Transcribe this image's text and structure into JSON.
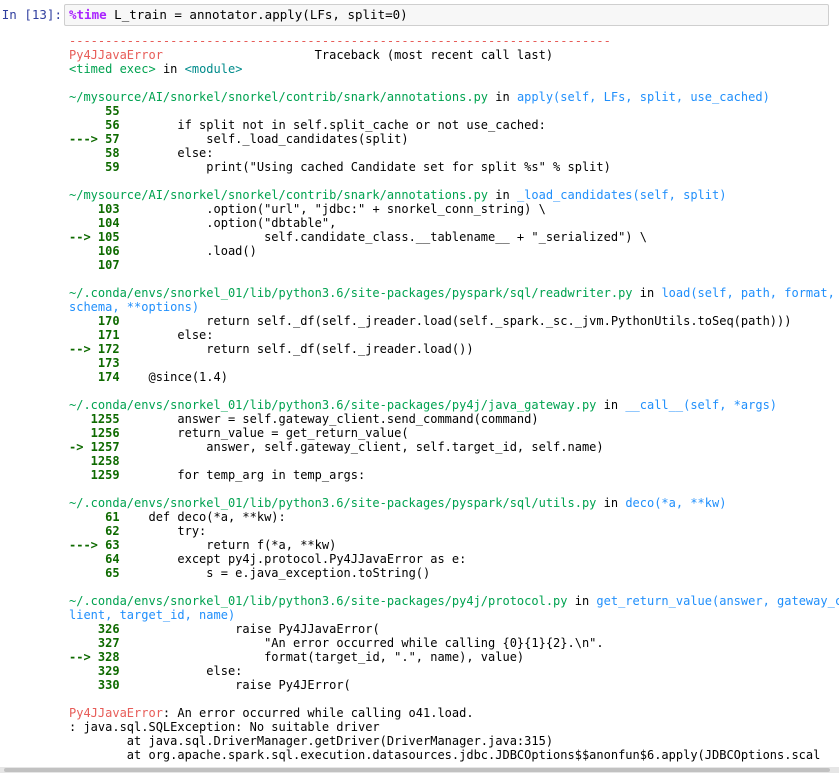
{
  "cell": {
    "prompt": "In [13]:",
    "magic": "%time",
    "code_rest": " L_train = annotator.apply(LFs, split=0)"
  },
  "output": {
    "separator": "---------------------------------------------------------------------------",
    "error_name": "Py4JJavaError",
    "traceback_label": "Traceback (most recent call last)",
    "timed_exec": "<timed exec>",
    "in_word": "in",
    "module": "<module>",
    "frames": [
      {
        "path": "~/mysource/AI/snorkel/snorkel/contrib/snark/annotations.py",
        "func": "apply(self, LFs, split, use_cached)",
        "lines": [
          {
            "marker": "     55",
            "code": ""
          },
          {
            "marker": "     56",
            "code": "        if split not in self.split_cache or not use_cached:"
          },
          {
            "marker": "---> 57",
            "code": "            self._load_candidates(split)"
          },
          {
            "marker": "     58",
            "code": "        else:"
          },
          {
            "marker": "     59",
            "code": "            print(\"Using cached Candidate set for split %s\" % split)"
          }
        ]
      },
      {
        "path": "~/mysource/AI/snorkel/snorkel/contrib/snark/annotations.py",
        "func": "_load_candidates(self, split)",
        "lines": [
          {
            "marker": "    103",
            "code": "            .option(\"url\", \"jdbc:\" + snorkel_conn_string) \\"
          },
          {
            "marker": "    104",
            "code": "            .option(\"dbtable\","
          },
          {
            "marker": "--> 105",
            "code": "                    self.candidate_class.__tablename__ + \"_serialized\") \\"
          },
          {
            "marker": "    106",
            "code": "            .load()"
          },
          {
            "marker": "    107",
            "code": ""
          }
        ]
      },
      {
        "path": "~/.conda/envs/snorkel_01/lib/python3.6/site-packages/pyspark/sql/readwriter.py",
        "func": "load(self, path, format, schema, **options)",
        "lines": [
          {
            "marker": "    170",
            "code": "            return self._df(self._jreader.load(self._spark._sc._jvm.PythonUtils.toSeq(path)))"
          },
          {
            "marker": "    171",
            "code": "        else:"
          },
          {
            "marker": "--> 172",
            "code": "            return self._df(self._jreader.load())"
          },
          {
            "marker": "    173",
            "code": ""
          },
          {
            "marker": "    174",
            "code": "    @since(1.4)"
          }
        ]
      },
      {
        "path": "~/.conda/envs/snorkel_01/lib/python3.6/site-packages/py4j/java_gateway.py",
        "func": "__call__(self, *args)",
        "lines": [
          {
            "marker": "   1255",
            "code": "        answer = self.gateway_client.send_command(command)"
          },
          {
            "marker": "   1256",
            "code": "        return_value = get_return_value("
          },
          {
            "marker": "-> 1257",
            "code": "            answer, self.gateway_client, self.target_id, self.name)"
          },
          {
            "marker": "   1258",
            "code": ""
          },
          {
            "marker": "   1259",
            "code": "        for temp_arg in temp_args:"
          }
        ]
      },
      {
        "path": "~/.conda/envs/snorkel_01/lib/python3.6/site-packages/pyspark/sql/utils.py",
        "func": "deco(*a, **kw)",
        "lines": [
          {
            "marker": "     61",
            "code": "    def deco(*a, **kw):"
          },
          {
            "marker": "     62",
            "code": "        try:"
          },
          {
            "marker": "---> 63",
            "code": "            return f(*a, **kw)"
          },
          {
            "marker": "     64",
            "code": "        except py4j.protocol.Py4JJavaError as e:"
          },
          {
            "marker": "     65",
            "code": "            s = e.java_exception.toString()"
          }
        ]
      },
      {
        "path": "~/.conda/envs/snorkel_01/lib/python3.6/site-packages/py4j/protocol.py",
        "func": "get_return_value(answer, gateway_client, target_id, name)",
        "lines": [
          {
            "marker": "    326",
            "code": "                raise Py4JJavaError("
          },
          {
            "marker": "    327",
            "code": "                    \"An error occurred while calling {0}{1}{2}.\\n\"."
          },
          {
            "marker": "--> 328",
            "code": "                    format(target_id, \".\", name), value)"
          },
          {
            "marker": "    329",
            "code": "            else:"
          },
          {
            "marker": "    330",
            "code": "                raise Py4JError("
          }
        ]
      }
    ],
    "final_error_name": "Py4JJavaError",
    "final_error_msg": ": An error occurred while calling o41.load.",
    "java_lines": [
      ": java.sql.SQLException: No suitable driver",
      "\tat java.sql.DriverManager.getDriver(DriverManager.java:315)",
      "\tat org.apache.spark.sql.execution.datasources.jdbc.JDBCOptions$$anonfun$6.apply(JDBCOptions.scal"
    ]
  }
}
